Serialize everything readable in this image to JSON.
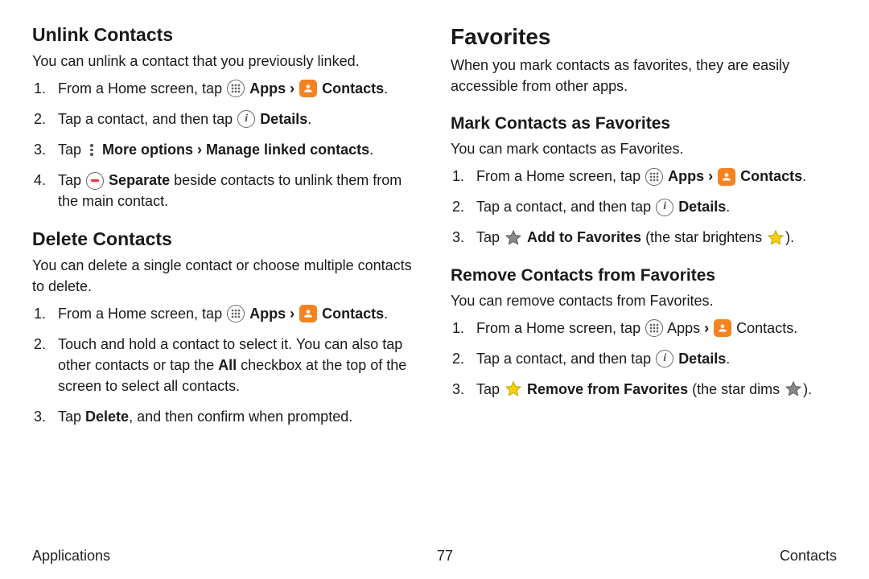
{
  "left": {
    "h2a": "Unlink Contacts",
    "p1": "You can unlink a contact that you previously linked.",
    "s1": {
      "pre": "From a Home screen, tap ",
      "apps": " Apps",
      "caret": " › ",
      "contacts": " Contacts",
      "post": "."
    },
    "s2": {
      "pre": "Tap a contact, and then tap ",
      "details": " Details",
      "post": "."
    },
    "s3": {
      "pre": "Tap ",
      "more": " More options › Manage linked contacts",
      "post": "."
    },
    "s4": {
      "pre": "Tap ",
      "sep": " Separate",
      "post": " beside contacts to unlink them from the main contact."
    },
    "h2b": "Delete Contacts",
    "p2": "You can delete a single contact or choose multiple contacts to delete.",
    "d1": {
      "pre": "From a Home screen, tap ",
      "apps": " Apps",
      "caret": " › ",
      "contacts": " Contacts",
      "post": "."
    },
    "d2": {
      "pre": "Touch and hold a contact to select it. You can also tap other contacts or tap the ",
      "all": "All",
      "post": " checkbox at the top of the screen to select all contacts."
    },
    "d3": {
      "pre": "Tap ",
      "del": "Delete",
      "post": ", and then confirm when prompted."
    }
  },
  "right": {
    "h1": "Favorites",
    "p1": "When you mark contacts as favorites, they are easily accessible from other apps.",
    "h3a": "Mark Contacts as Favorites",
    "p2": "You can mark contacts as Favorites.",
    "m1": {
      "pre": "From a Home screen, tap ",
      "apps": " Apps",
      "caret": " › ",
      "contacts": " Contacts",
      "post": "."
    },
    "m2": {
      "pre": "Tap a contact, and then tap ",
      "details": " Details",
      "post": "."
    },
    "m3": {
      "pre": "Tap ",
      "add": " Add to Favorites",
      "mid": " (the star brightens ",
      "post": ")."
    },
    "h3b": "Remove Contacts from Favorites",
    "p3": "You can remove contacts from Favorites.",
    "r1": {
      "pre": "From a Home screen, tap ",
      "apps": " Apps",
      "caret": " › ",
      "contacts": " Contacts",
      "post": "."
    },
    "r2": {
      "pre": "Tap a contact, and then tap ",
      "details": " Details",
      "post": "."
    },
    "r3": {
      "pre": "Tap ",
      "rem": " Remove from Favorites",
      "mid": " (the star dims ",
      "post": ")."
    }
  },
  "footer": {
    "left": "Applications",
    "center": "77",
    "right": "Contacts"
  }
}
